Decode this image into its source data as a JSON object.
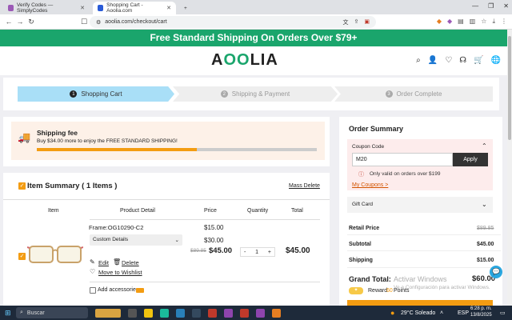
{
  "browser": {
    "tabs": [
      {
        "title": "Verify Codes — SimplyCodes",
        "active": false
      },
      {
        "title": "Shopping Cart - Aoolia.com",
        "active": true
      }
    ],
    "new_tab": "+",
    "url": "aoolia.com/checkout/cart"
  },
  "promo": {
    "text": "Free Shipping On Orders Over $79+",
    "prefix": "Free Standard Shipping On Orders Over $79+"
  },
  "logo": {
    "part1": "A",
    "part2": "OO",
    "part3": "LIA"
  },
  "steps": [
    {
      "num": "1",
      "label": "Shopping Cart"
    },
    {
      "num": "2",
      "label": "Shipping & Payment"
    },
    {
      "num": "3",
      "label": "Order Complete"
    }
  ],
  "shipping": {
    "title": "Shipping fee",
    "message": "Buy $34.00 more to enjoy the FREE STANDARD SHIPPING!",
    "progress": 0.57
  },
  "items": {
    "title": "Item Summary ( 1 Items )",
    "mass_delete": "Mass Delete",
    "columns": [
      "Item",
      "Product Detail",
      "Price",
      "Quantity",
      "Total"
    ],
    "product": {
      "frame": "Frame:OG10290-C2",
      "frame_price": "$15.00",
      "option": "Custom Details",
      "option_price": "$30.00",
      "old_price": "$89.85",
      "price": "$45.00",
      "quantity": "1",
      "minus": "-",
      "plus": "+",
      "total": "$45.00",
      "edit": "Edit",
      "delete": "Delete",
      "wishlist": "Move to Wishlist"
    },
    "add_accessories": "Add accessories"
  },
  "summary": {
    "title": "Order Summary",
    "coupon_label": "Coupon Code",
    "coupon_value": "M20",
    "apply": "Apply",
    "coupon_error": "Only valid on orders over $199",
    "my_coupons": "My Coupons >",
    "gift_card": "Gift Card",
    "retail_label": "Retail Price",
    "retail_value": "$89.85",
    "subtotal_label": "Subtotal",
    "subtotal_value": "$45.00",
    "shipping_label": "Shipping",
    "shipping_value": "$15.00",
    "grand_label": "Grand Total:",
    "grand_value": "$60.00",
    "reward": "Reward",
    "reward_points": "60",
    "points": "Points"
  },
  "windows_watermark": {
    "line1": "Activar Windows",
    "line2": "Ve a Configuración para activar Windows."
  },
  "taskbar": {
    "search": "Buscar",
    "weather": "29°C  Soleado",
    "lang": "ESP",
    "time": "6:28 p. m.",
    "date": "13/8/2025"
  },
  "colors": {
    "brand_green": "#1aa56c",
    "accent_orange": "#f39c12",
    "step_active": "#a9dff7"
  }
}
